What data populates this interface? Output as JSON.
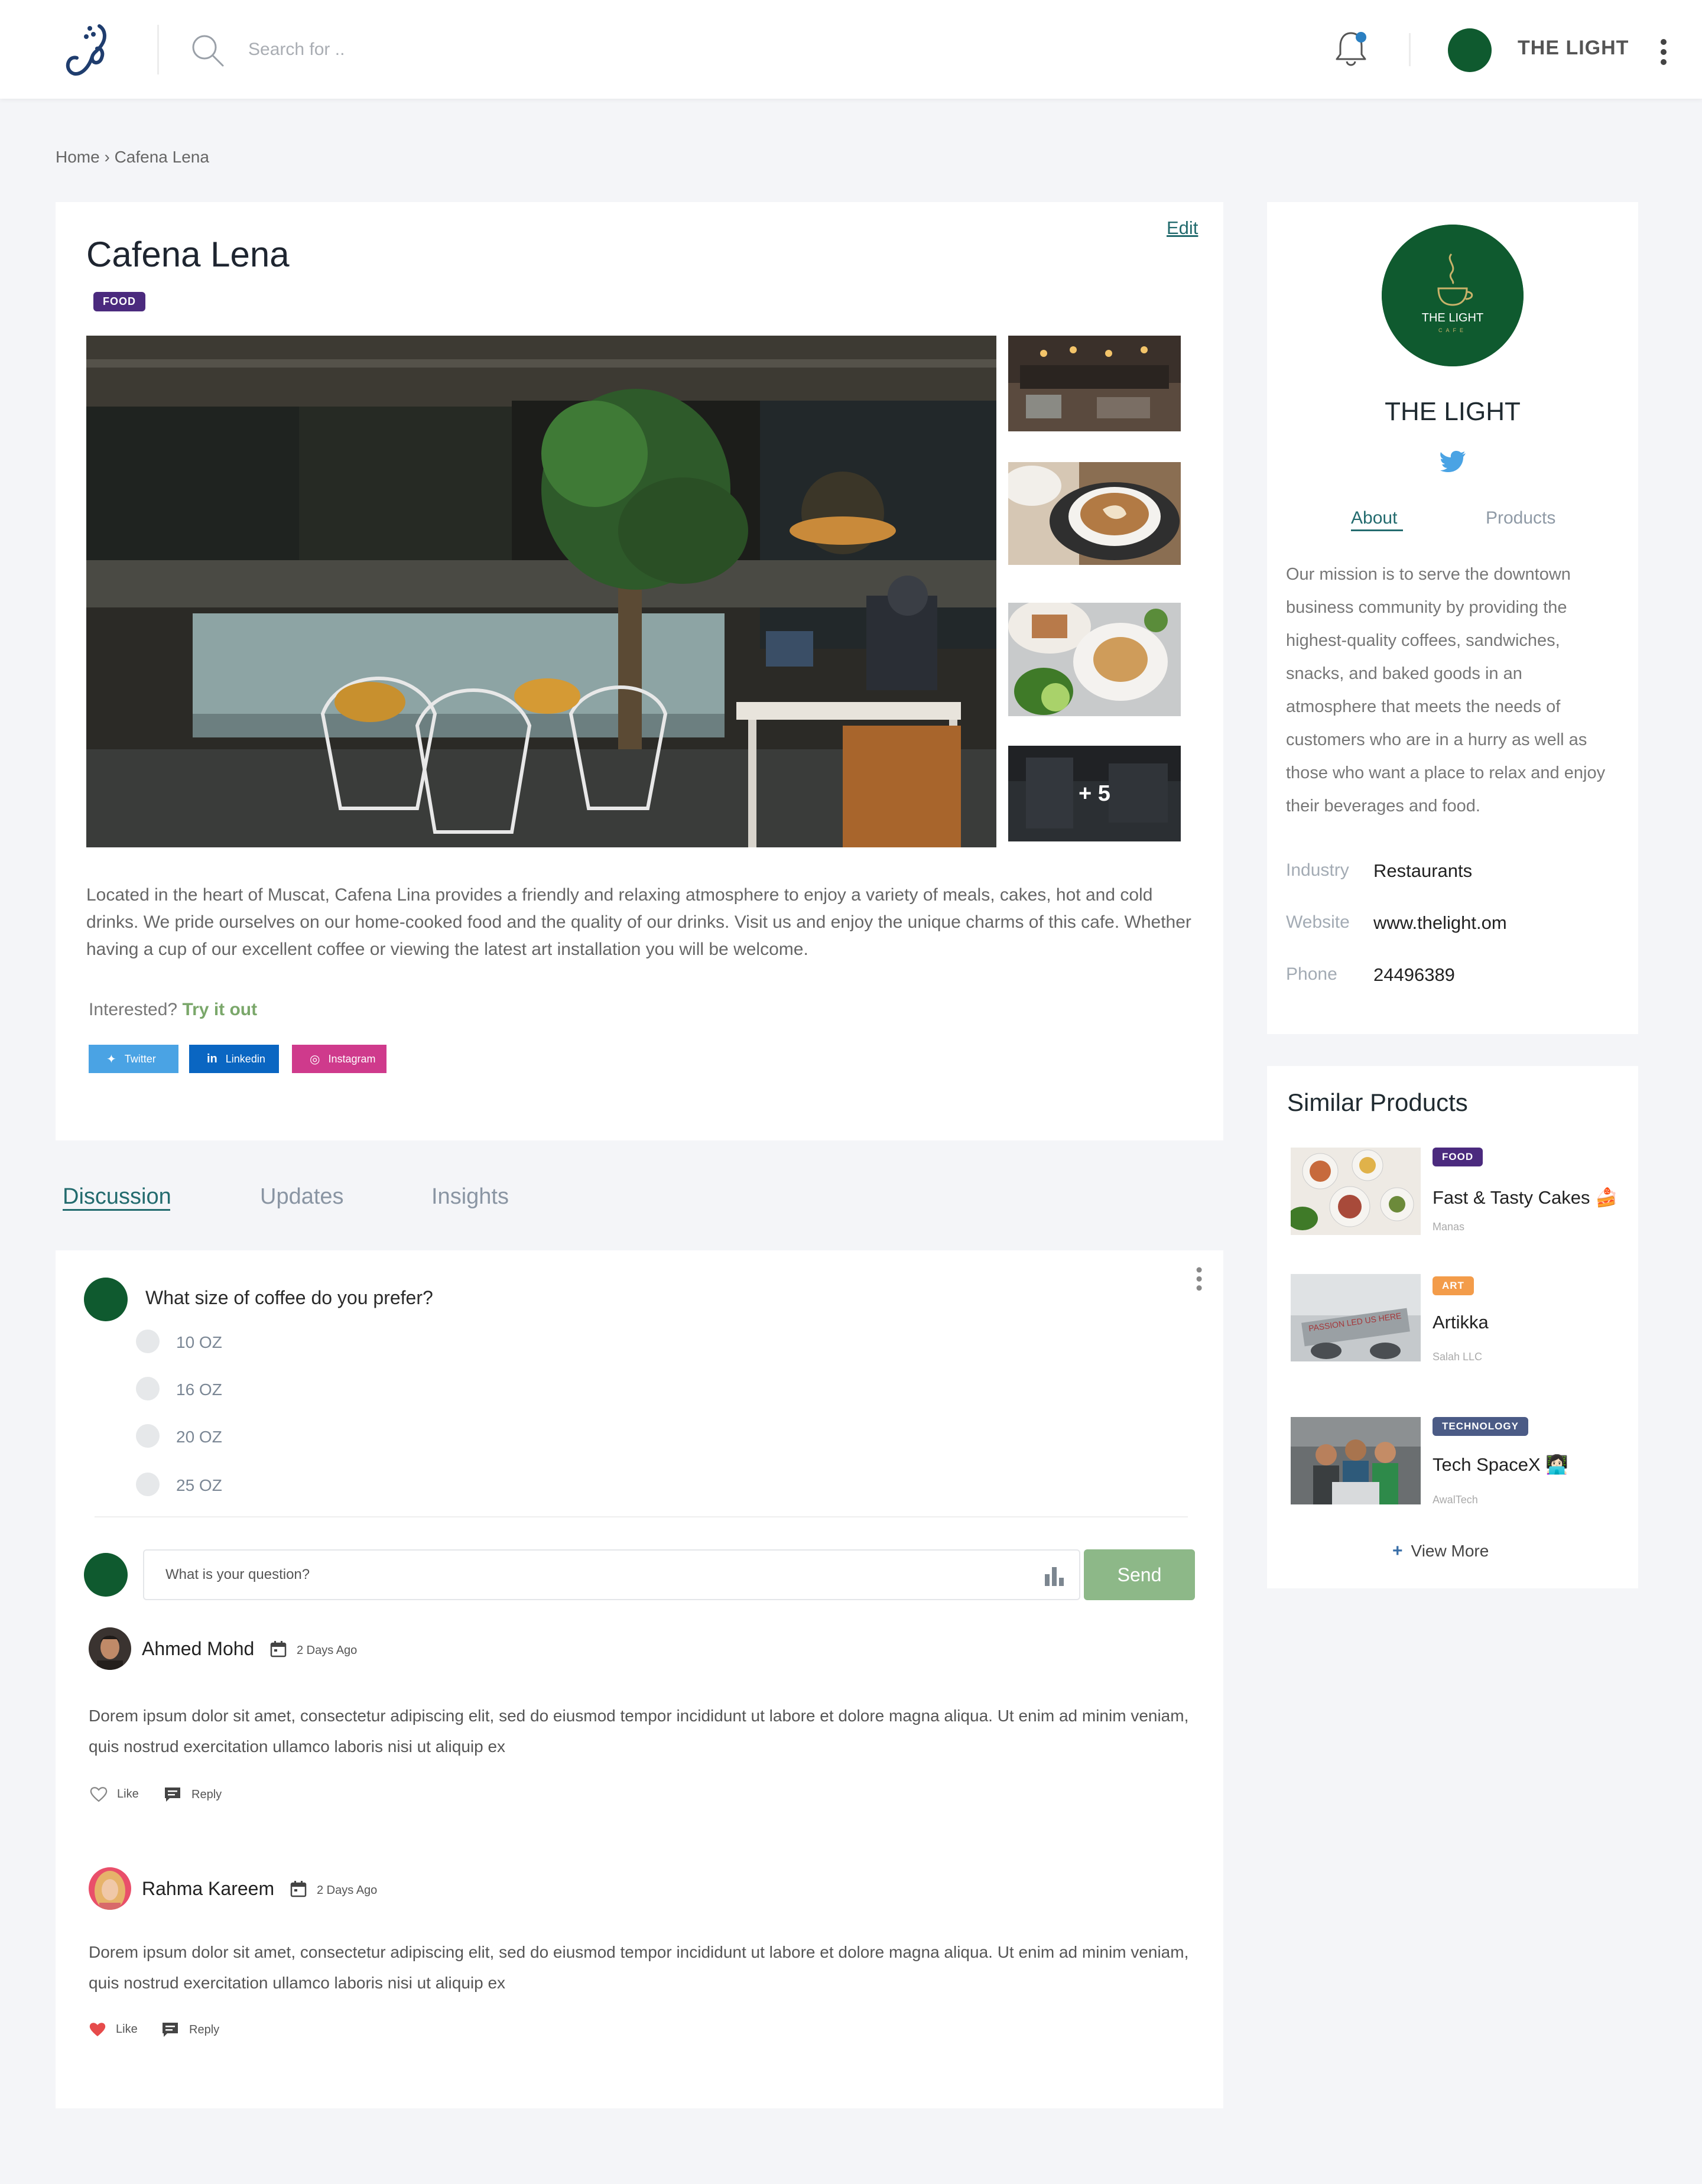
{
  "header": {
    "search_placeholder": "Search for ..",
    "user_name": "THE LIGHT"
  },
  "breadcrumb": "Home › Cafena Lena",
  "product": {
    "edit_label": "Edit",
    "title": "Cafena Lena",
    "category": "FOOD",
    "more_photos": "+ 5",
    "description": "Located in the heart of Muscat, Cafena Lina provides a friendly and relaxing atmosphere to enjoy a variety of meals, cakes, hot and cold drinks. We pride ourselves on our home-cooked food and the quality of our drinks. Visit us and enjoy the unique charms of this cafe. Whether having a cup of our excellent coffee or viewing the latest art installation you will be welcome.",
    "interested_text": "Interested?",
    "try_link": "Try it out",
    "share": {
      "twitter": "Twitter",
      "linkedin": "Linkedin",
      "instagram": "Instagram"
    }
  },
  "tabs": {
    "discussion": "Discussion",
    "updates": "Updates",
    "insights": "Insights"
  },
  "poll": {
    "question": "What size of coffee do you prefer?",
    "options": [
      "10 OZ",
      "16 OZ",
      "20 OZ",
      "25 OZ"
    ]
  },
  "ask": {
    "placeholder": "What is your question?",
    "send_label": "Send"
  },
  "comments": [
    {
      "author": "Ahmed Mohd",
      "time": "2 Days Ago",
      "body": "Dorem ipsum dolor sit amet, consectetur adipiscing elit, sed do eiusmod tempor incididunt ut labore et dolore magna aliqua. Ut enim ad minim veniam, quis nostrud exercitation ullamco laboris nisi ut aliquip ex",
      "like_label": "Like",
      "reply_label": "Reply",
      "liked": false
    },
    {
      "author": "Rahma Kareem",
      "time": "2 Days Ago",
      "body": "Dorem ipsum dolor sit amet, consectetur adipiscing elit, sed do eiusmod tempor incididunt ut labore et dolore magna aliqua. Ut enim ad minim veniam, quis nostrud exercitation ullamco laboris nisi ut aliquip ex",
      "like_label": "Like",
      "reply_label": "Reply",
      "liked": true
    }
  ],
  "profile": {
    "logo_text": "THE LIGHT",
    "logo_sub": "CAFE",
    "name": "THE LIGHT",
    "tab_about": "About",
    "tab_products": "Products",
    "mission": "Our mission is to serve the downtown business community by providing the highest-quality coffees, sandwiches, snacks, and baked goods in an atmosphere that meets the needs of customers who are in a hurry as well as those who want a place to relax and enjoy their beverages and food.",
    "info": [
      {
        "label": "Industry",
        "value": "Restaurants"
      },
      {
        "label": "Website",
        "value": "www.thelight.om"
      },
      {
        "label": "Phone",
        "value": "24496389"
      }
    ]
  },
  "similar": {
    "title": "Similar Products",
    "items": [
      {
        "badge": "FOOD",
        "name": "Fast & Tasty Cakes 🍰",
        "company": "Manas"
      },
      {
        "badge": "ART",
        "name": "Artikka",
        "company": "Salah LLC"
      },
      {
        "badge": "TECHNOLOGY",
        "name": "Tech SpaceX 👩🏻‍💻",
        "company": "AwalTech"
      }
    ],
    "view_more": "View More"
  },
  "colors": {
    "brand_green": "#0f5a2f",
    "accent_teal": "#236b6e",
    "send_green": "#8db888",
    "food_badge": "#4b2a7e",
    "art_badge": "#f39c4a",
    "tech_badge": "#4b5b86"
  }
}
